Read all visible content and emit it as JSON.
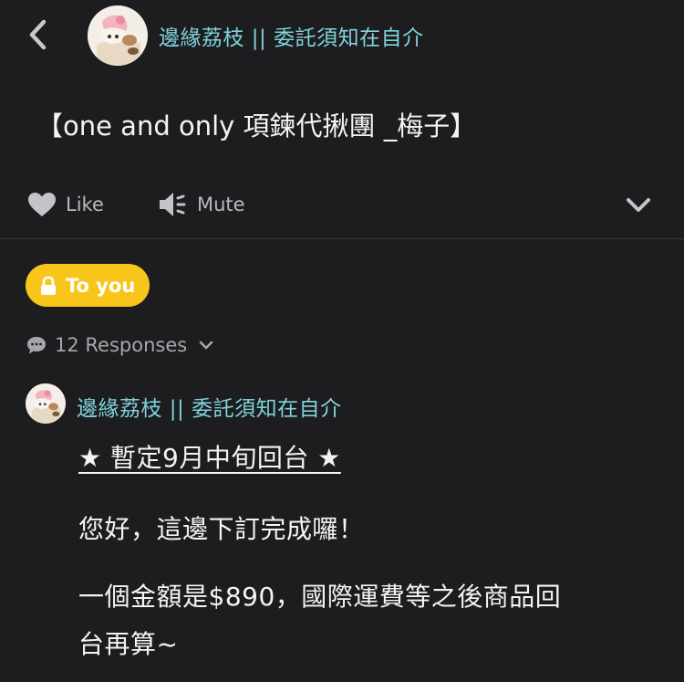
{
  "header": {
    "author_name": "邊緣荔枝 || 委託須知在自介"
  },
  "post": {
    "title": "【one and only 項鍊代揪團 _梅子】"
  },
  "actions": {
    "like_label": "Like",
    "mute_label": "Mute"
  },
  "badge": {
    "label": "To you"
  },
  "responses": {
    "label": "12 Responses"
  },
  "reply": {
    "author_name": "邊緣荔枝 || 委託須知在自介",
    "lines": [
      "★ 暫定9月中旬回台 ★",
      "您好，這邊下訂完成囉！",
      "一個金額是$890，國際運費等之後商品回",
      "台再算~"
    ]
  },
  "colors": {
    "background": "#1d1c1f",
    "author_name": "#7fd3dc",
    "badge": "#f8c61a",
    "muted_text": "#b9b9bd"
  },
  "icons": [
    "back-chevron-icon",
    "heart-icon",
    "speaker-mute-icon",
    "chevron-down-icon",
    "lock-icon",
    "chat-bubble-icon"
  ]
}
